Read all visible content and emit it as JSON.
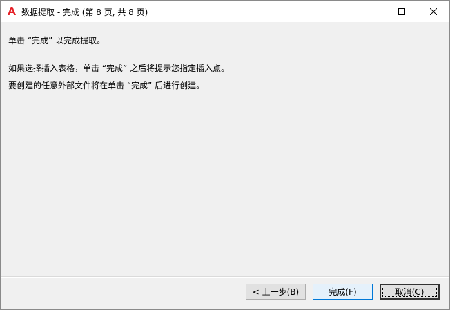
{
  "window": {
    "title": "数据提取 - 完成 (第 8 页, 共 8 页)"
  },
  "content": {
    "line1": "单击 “完成” 以完成提取。",
    "line2": "如果选择插入表格，单击 “完成” 之后将提示您指定插入点。",
    "line3": "要创建的任意外部文件将在单击 “完成” 后进行创建。"
  },
  "buttons": {
    "back_prefix": "< 上一步(",
    "back_key": "B",
    "back_suffix": ")",
    "finish_prefix": "完成(",
    "finish_key": "F",
    "finish_suffix": ")",
    "cancel_prefix": "取消(",
    "cancel_key": "C",
    "cancel_suffix": ")"
  },
  "colors": {
    "accent": "#0078d7",
    "app_icon": "#e51e25",
    "background": "#f0f0f0"
  },
  "icons": {
    "app": "autocad-a-icon",
    "minimize": "minimize-icon",
    "maximize": "maximize-icon",
    "close": "close-icon"
  }
}
